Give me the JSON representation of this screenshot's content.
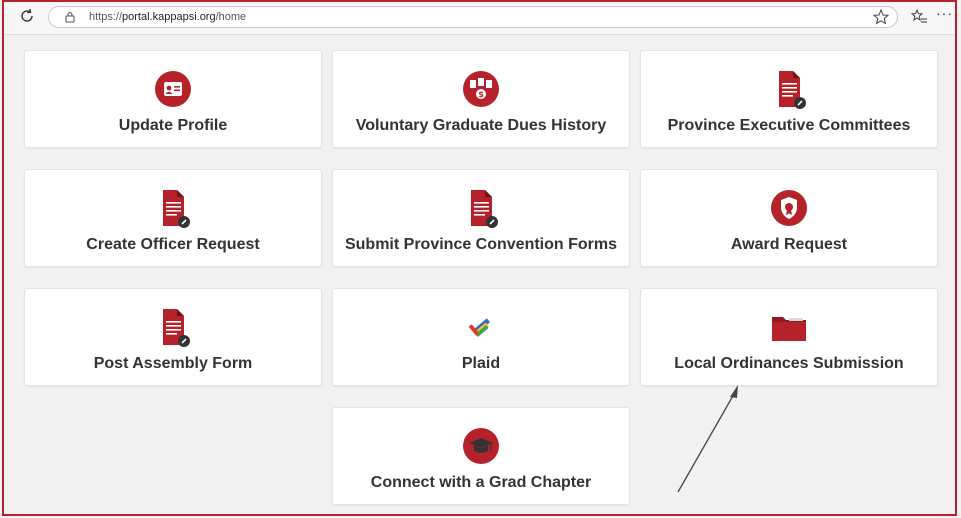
{
  "browser": {
    "url_scheme": "https://",
    "url_host": "portal.kappapsi.org",
    "url_path": "/home",
    "more_label": "···"
  },
  "tiles": [
    {
      "label": "Update Profile",
      "icon": "profile-card-icon"
    },
    {
      "label": "Voluntary Graduate Dues History",
      "icon": "dues-documents-icon"
    },
    {
      "label": "Province Executive Committees",
      "icon": "document-icon"
    },
    {
      "label": "Create Officer Request",
      "icon": "document-icon"
    },
    {
      "label": "Submit Province Convention Forms",
      "icon": "document-icon"
    },
    {
      "label": "Award Request",
      "icon": "award-shield-icon"
    },
    {
      "label": "Post Assembly Form",
      "icon": "document-icon"
    },
    {
      "label": "Plaid",
      "icon": "plaid-logo-icon"
    },
    {
      "label": "Local Ordinances Submission",
      "icon": "folder-icon"
    },
    {
      "label": "Connect with a Grad Chapter",
      "icon": "graduation-cap-icon"
    }
  ],
  "colors": {
    "accent": "#b5222a",
    "text": "#333333",
    "background": "#f2f2f2"
  }
}
